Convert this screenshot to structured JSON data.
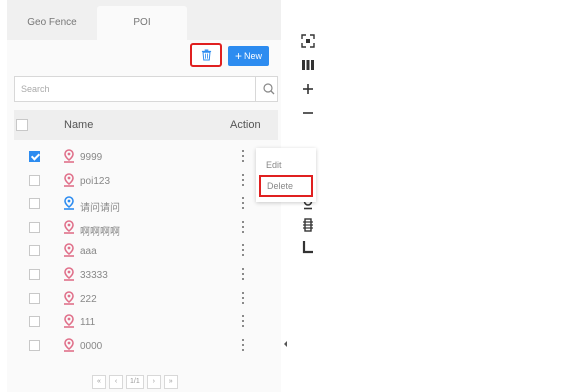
{
  "tabs": [
    {
      "label": "Geo Fence",
      "active": false
    },
    {
      "label": "POI",
      "active": true
    }
  ],
  "toolbar": {
    "delete_icon": "trash-icon",
    "new_label": "New"
  },
  "search": {
    "placeholder": "Search",
    "value": ""
  },
  "table": {
    "columns": [
      "Name",
      "Action"
    ],
    "rows": [
      {
        "name": "9999",
        "checked": true,
        "pin_color": "#e0708a"
      },
      {
        "name": "poi123",
        "checked": false,
        "pin_color": "#e0708a"
      },
      {
        "name": "请问请问",
        "checked": false,
        "pin_color": "#2d8cf0"
      },
      {
        "name": "啊啊啊啊",
        "checked": false,
        "pin_color": "#e0708a"
      },
      {
        "name": "aaa",
        "checked": false,
        "pin_color": "#e0708a"
      },
      {
        "name": "33333",
        "checked": false,
        "pin_color": "#e0708a"
      },
      {
        "name": "222",
        "checked": false,
        "pin_color": "#e0708a"
      },
      {
        "name": "111",
        "checked": false,
        "pin_color": "#e0708a"
      },
      {
        "name": "0000",
        "checked": false,
        "pin_color": "#e0708a"
      }
    ]
  },
  "context_menu": {
    "edit_label": "Edit",
    "delete_label": "Delete"
  },
  "pagination": {
    "first": "«",
    "prev": "‹",
    "page": "1/1",
    "next": "›",
    "last": "»"
  },
  "map_tools": [
    "fullscreen-icon",
    "layers-icon",
    "zoom-in-icon",
    "zoom-out-icon",
    "measure-icon",
    "pin-tool-icon",
    "traffic-icon",
    "line-tool-icon"
  ],
  "colors": {
    "accent": "#2d8cf0",
    "highlight": "#e02020",
    "pin": "#e0708a"
  }
}
